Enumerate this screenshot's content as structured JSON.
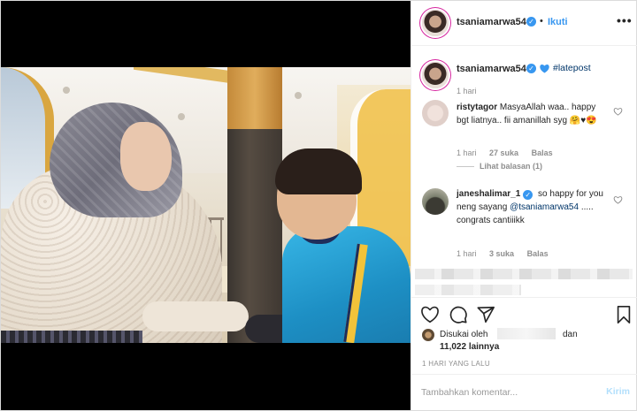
{
  "post": {
    "username": "tsaniamarwa54",
    "follow_label": "Ikuti",
    "more_label": "•••",
    "separator": "•"
  },
  "caption": {
    "username": "tsaniamarwa54",
    "hashtag": "#latepost",
    "time": "1 hari",
    "heart_color": "#3897f0"
  },
  "comments": [
    {
      "username": "ristytagor",
      "text": "MasyaAllah waa.. happy bgt liatnya.. fii amanillah syg 🤗♥😍",
      "time": "1 hari",
      "likes": "27 suka",
      "reply_label": "Balas",
      "view_replies": "Lihat balasan (1)"
    },
    {
      "username": "janeshalimar_1",
      "text_pre": "so happy for you neng sayang",
      "mention": "@tsaniamarwa54",
      "text_post": "..... congrats cantiiikk",
      "time": "1 hari",
      "likes": "3 suka",
      "reply_label": "Balas"
    }
  ],
  "likes": {
    "prefix": "Disukai oleh",
    "joiner": "dan",
    "count": "11,022 lainnya"
  },
  "post_time": "1 HARI YANG LALU",
  "add_comment": {
    "placeholder": "Tambahkan komentar...",
    "post_label": "Kirim"
  },
  "colors": {
    "accent": "#3897f0",
    "link": "#003569",
    "muted": "#8e8e8e"
  },
  "icons": [
    "heart-icon",
    "comment-icon",
    "share-icon",
    "bookmark-icon",
    "more-icon",
    "verified-icon"
  ]
}
